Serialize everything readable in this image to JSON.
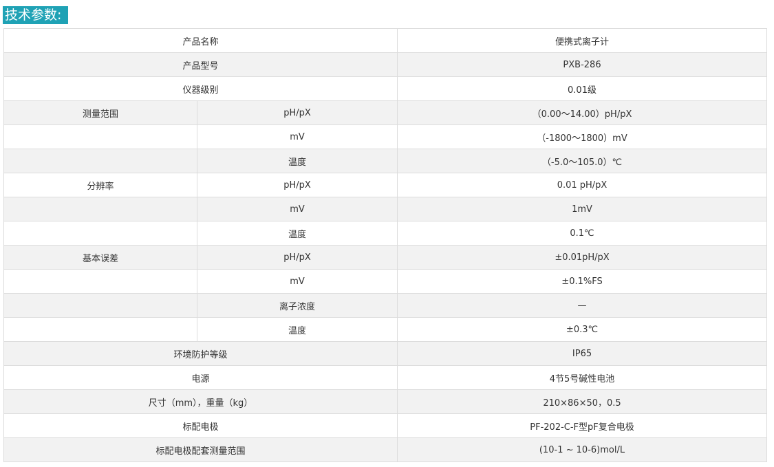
{
  "section_title": "技术参数:",
  "rows": [
    {
      "type": "pair",
      "label": "产品名称",
      "value": "便携式离子计"
    },
    {
      "type": "pair",
      "label": "产品型号",
      "value": "PXB-286"
    },
    {
      "type": "pair",
      "label": "仪器级别",
      "value": "0.01级"
    },
    {
      "type": "triple",
      "group": "测量范围",
      "sub": "pH/pX",
      "value": "（0.00～14.00）pH/pX"
    },
    {
      "type": "triple",
      "group": "",
      "sub": "mV",
      "value": "（-1800～1800）mV"
    },
    {
      "type": "triple",
      "group": "",
      "sub": "温度",
      "value": "（-5.0～105.0）℃"
    },
    {
      "type": "triple",
      "group": "分辨率",
      "sub": "pH/pX",
      "value": "0.01 pH/pX"
    },
    {
      "type": "triple",
      "group": "",
      "sub": "mV",
      "value": "1mV"
    },
    {
      "type": "triple",
      "group": "",
      "sub": "温度",
      "value": "0.1℃"
    },
    {
      "type": "triple",
      "group": "基本误差",
      "sub": "pH/pX",
      "value": "±0.01pH/pX"
    },
    {
      "type": "triple",
      "group": "",
      "sub": "mV",
      "value": "±0.1%FS"
    },
    {
      "type": "triple",
      "group": "",
      "sub": "离子浓度",
      "value": "—"
    },
    {
      "type": "triple",
      "group": "",
      "sub": "温度",
      "value": "±0.3℃"
    },
    {
      "type": "pair",
      "label": "环境防护等级",
      "value": "IP65"
    },
    {
      "type": "pair",
      "label": "电源",
      "value": "4节5号碱性电池"
    },
    {
      "type": "pair",
      "label": "尺寸（mm），重量（kg）",
      "value": "210×86×50，0.5"
    },
    {
      "type": "pair",
      "label": "标配电极",
      "value": "PF-202-C-F型pF复合电极"
    },
    {
      "type": "pair",
      "label": "标配电极配套测量范围",
      "value": "(10-1 ~ 10-6)mol/L"
    }
  ],
  "colors": {
    "title_bg": "#1fa2b5",
    "row_even_bg": "#f2f2f2",
    "border": "#dcdcdc"
  }
}
